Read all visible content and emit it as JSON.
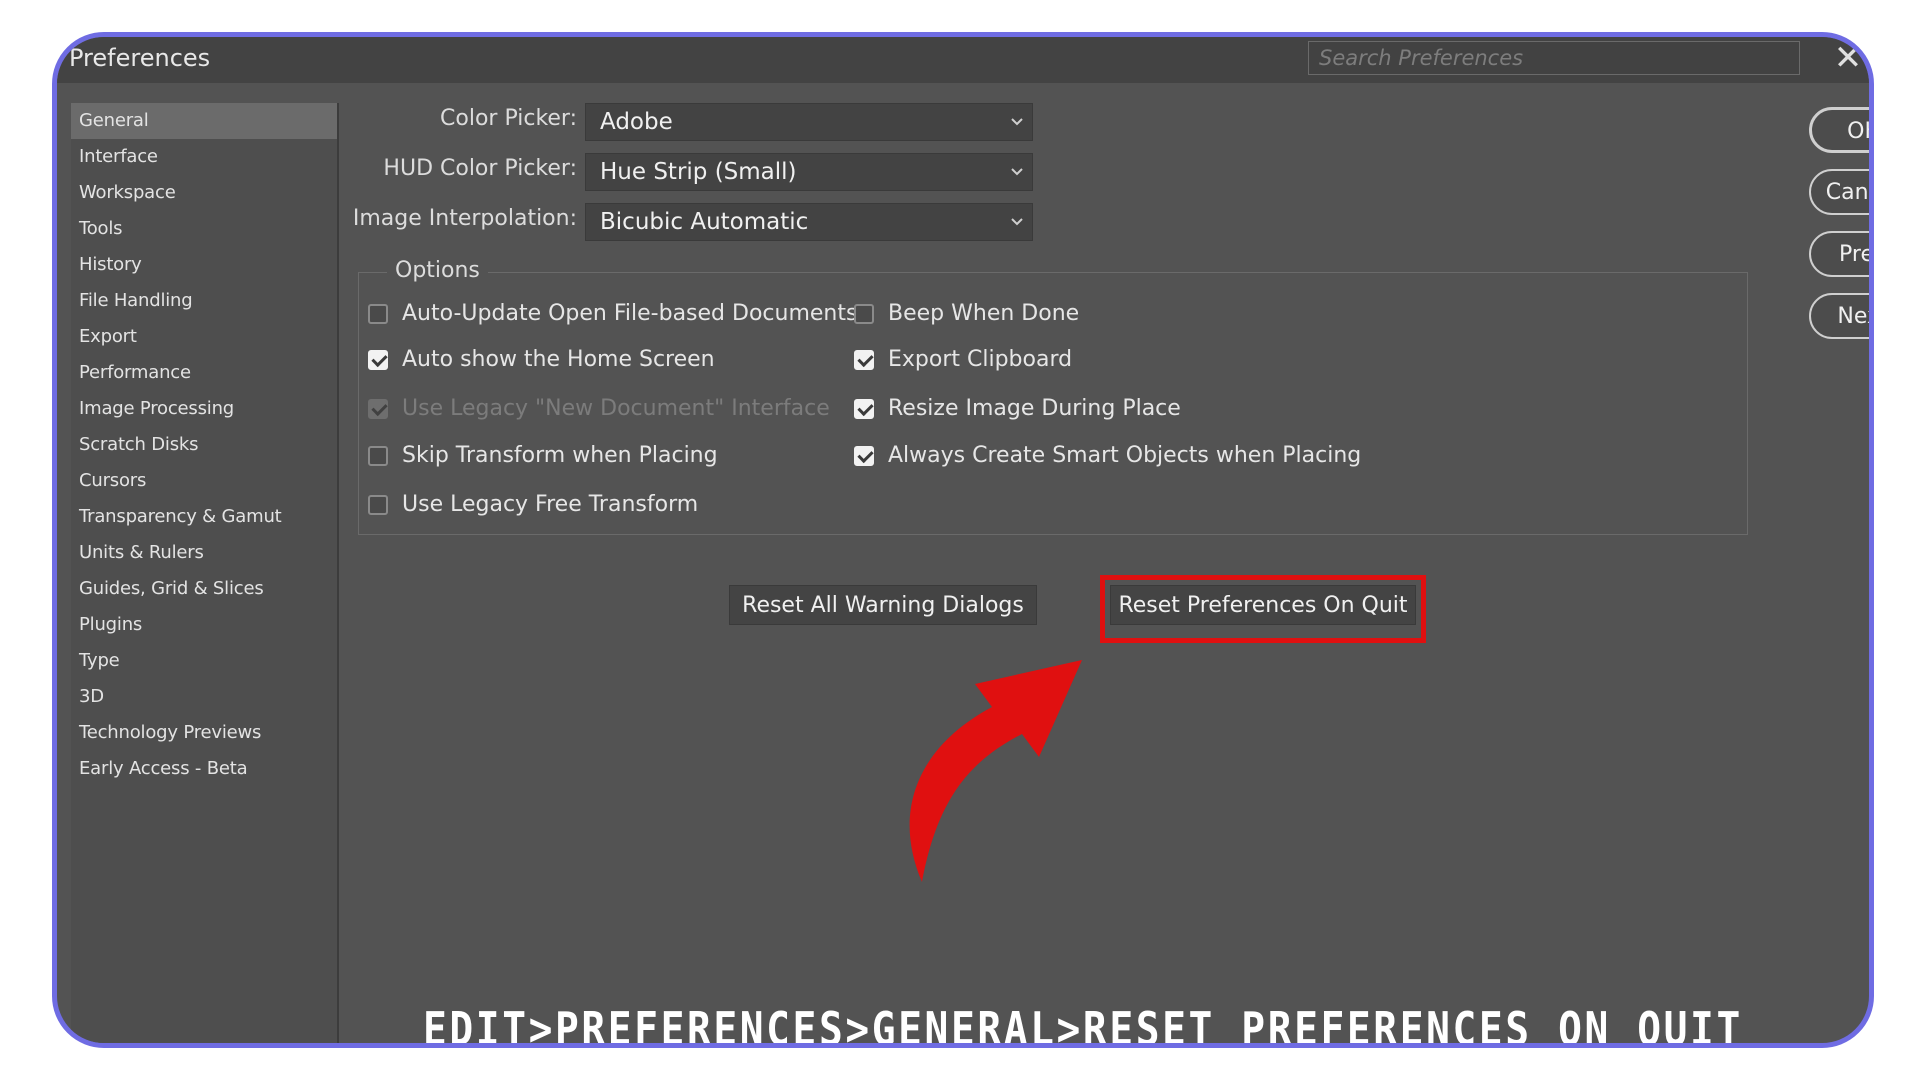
{
  "window": {
    "title": "Preferences",
    "search_placeholder": "Search Preferences"
  },
  "sidebar": {
    "items": [
      {
        "label": "General",
        "active": true
      },
      {
        "label": "Interface"
      },
      {
        "label": "Workspace"
      },
      {
        "label": "Tools"
      },
      {
        "label": "History"
      },
      {
        "label": "File Handling"
      },
      {
        "label": "Export"
      },
      {
        "label": "Performance"
      },
      {
        "label": "Image Processing"
      },
      {
        "label": "Scratch Disks"
      },
      {
        "label": "Cursors"
      },
      {
        "label": "Transparency & Gamut"
      },
      {
        "label": "Units & Rulers"
      },
      {
        "label": "Guides, Grid & Slices"
      },
      {
        "label": "Plugins"
      },
      {
        "label": "Type"
      },
      {
        "label": "3D"
      },
      {
        "label": "Technology Previews"
      },
      {
        "label": "Early Access - Beta"
      }
    ]
  },
  "fields": {
    "color_picker": {
      "label": "Color Picker:",
      "value": "Adobe"
    },
    "hud_color_picker": {
      "label": "HUD Color Picker:",
      "value": "Hue Strip (Small)"
    },
    "image_interpolation": {
      "label": "Image Interpolation:",
      "value": "Bicubic Automatic"
    }
  },
  "options": {
    "legend": "Options",
    "left": [
      {
        "label": "Auto-Update Open File-based Documents",
        "checked": false
      },
      {
        "label": "Auto show the Home Screen",
        "checked": true
      },
      {
        "label": "Use Legacy \"New Document\" Interface",
        "checked": true,
        "disabled": true
      },
      {
        "label": "Skip Transform when Placing",
        "checked": false
      },
      {
        "label": "Use Legacy Free Transform",
        "checked": false
      }
    ],
    "right": [
      {
        "label": "Beep When Done",
        "checked": false
      },
      {
        "label": "Export Clipboard",
        "checked": true
      },
      {
        "label": "Resize Image During Place",
        "checked": true
      },
      {
        "label": "Always Create Smart Objects when Placing",
        "checked": true
      }
    ]
  },
  "buttons": {
    "reset_warning": "Reset All Warning Dialogs",
    "reset_prefs": "Reset Preferences On Quit",
    "ok": "OK",
    "cancel": "Cancel",
    "prev": "Prev",
    "next": "Next"
  },
  "annotation": {
    "caption": "EDIT>PREFERENCES>GENERAL>RESET PREFERENCES ON QUIT",
    "highlight_color": "#e01010",
    "arrow_color": "#e01010"
  }
}
